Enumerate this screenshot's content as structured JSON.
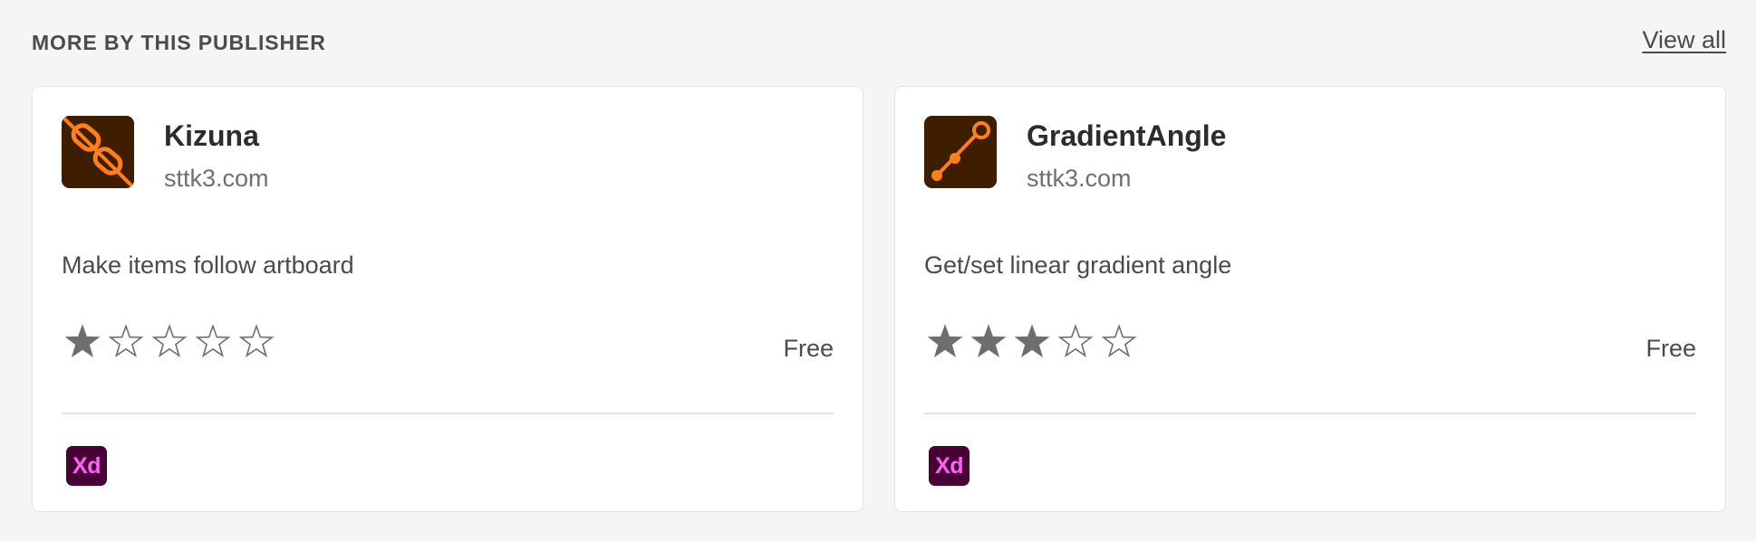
{
  "section": {
    "title": "MORE BY THIS PUBLISHER",
    "view_all_label": "View all"
  },
  "cards": [
    {
      "name": "Kizuna",
      "publisher": "sttk3.com",
      "description": "Make items follow artboard",
      "rating": 1,
      "rating_max": 5,
      "price": "Free",
      "app_badge": "Xd",
      "icon": "chain-link-icon"
    },
    {
      "name": "GradientAngle",
      "publisher": "sttk3.com",
      "description": "Get/set linear gradient angle",
      "rating": 3,
      "rating_max": 5,
      "price": "Free",
      "app_badge": "Xd",
      "icon": "gradient-angle-icon"
    }
  ],
  "colors": {
    "icon_background": "#3f1e00",
    "icon_accent": "#ff7f18",
    "xd_background": "#470137",
    "xd_text": "#ff61f6",
    "star": "#6e6e6e"
  }
}
